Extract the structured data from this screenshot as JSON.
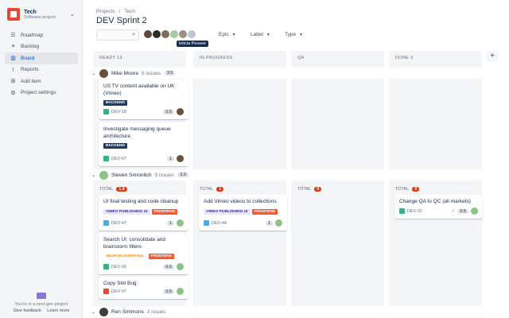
{
  "sidebar": {
    "project_name": "Tech",
    "project_type": "Software project",
    "items": [
      {
        "label": "Roadmap",
        "icon": "roadmap-icon"
      },
      {
        "label": "Backlog",
        "icon": "backlog-icon"
      },
      {
        "label": "Board",
        "icon": "board-icon",
        "active": true
      },
      {
        "label": "Reports",
        "icon": "reports-icon"
      },
      {
        "label": "Add item",
        "icon": "add-item-icon"
      },
      {
        "label": "Project settings",
        "icon": "settings-icon"
      }
    ],
    "footer_text": "You're in a next-gen project",
    "footer_link1": "Give feedback",
    "footer_link2": "Learn more"
  },
  "header": {
    "breadcrumb": [
      "Projects",
      "Tech"
    ],
    "title": "DEV Sprint 2",
    "tooltip": "leticia Pessee",
    "filters": [
      "Epic",
      "Label",
      "Type"
    ]
  },
  "columns": [
    {
      "name": "READY 13"
    },
    {
      "name": "IN PROGRESS"
    },
    {
      "name": "QA"
    },
    {
      "name": "DONE 3"
    }
  ],
  "swimlanes": [
    {
      "name": "Mike Moore",
      "count": "5 issues",
      "points": "3.5"
    },
    {
      "name": "Steven Simonitch",
      "count": "5 issues",
      "points": "2.5"
    },
    {
      "name": "Ren Simmons",
      "count": "3 issues"
    }
  ],
  "totals": [
    {
      "label": "TOTAL",
      "value": "1.6"
    },
    {
      "label": "TOTAL",
      "value": "1"
    },
    {
      "label": "TOTAL",
      "value": "0"
    },
    {
      "label": "TOTAL",
      "value": "0"
    }
  ],
  "cards": {
    "c1": {
      "title": "US TV content available on UK (Vimeo)",
      "labels": [
        "BACKEND"
      ],
      "key": "DEV-18",
      "est": "0.5"
    },
    "c2": {
      "title": "Investigate messaging queue architecture",
      "labels": [
        "BACKEND"
      ],
      "key": "DEV-67",
      "est": "1"
    },
    "c3": {
      "title": "UI final testing and code cleanup",
      "labels": [
        "VIMEO PUBLISHING UI",
        "FRONTEND"
      ],
      "key": "DEV-47",
      "est": "1"
    },
    "c4": {
      "title": "Add Vimeo videos to collections",
      "labels": [
        "VIMEO PUBLISHING UI",
        "FRONTEND"
      ],
      "key": "DEV-44",
      "est": "1"
    },
    "c5": {
      "title": "Change QA to QC (all markets)",
      "key": "DEV-32",
      "est": "0.5"
    },
    "c6": {
      "title": "Search UI: consolidate and brainstorm filters",
      "labels": [
        "SEARCH OVERHAUL",
        "FRONTEND"
      ],
      "key": "DEV-26",
      "est": "0.5"
    },
    "c7": {
      "title": "Copy Slot Bug",
      "key": "DEV-97",
      "est": "0.5"
    }
  }
}
